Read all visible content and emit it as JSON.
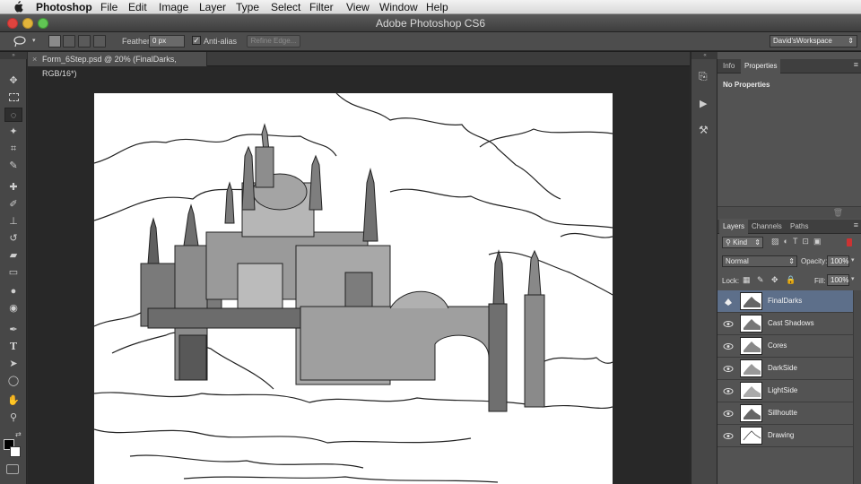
{
  "menubar": {
    "app": "Photoshop",
    "items": [
      "File",
      "Edit",
      "Image",
      "Layer",
      "Type",
      "Select",
      "Filter",
      "View",
      "Window",
      "Help"
    ]
  },
  "window": {
    "title": "Adobe Photoshop CS6"
  },
  "options": {
    "feather_label": "Feather:",
    "feather_value": "0 px",
    "antialias_label": "Anti-alias",
    "refine_edge": "Refine Edge...",
    "workspace": "David'sWorkspace"
  },
  "document": {
    "tab_title": "Form_6Step.psd @ 20% (FinalDarks, RGB/16*)",
    "close": "×"
  },
  "info_panel": {
    "tabs": [
      "Info",
      "Properties"
    ],
    "active_tab": "Properties",
    "message": "No Properties"
  },
  "layers_panel": {
    "tabs": [
      "Layers",
      "Channels",
      "Paths"
    ],
    "filter_kind": "Kind",
    "blend_mode": "Normal",
    "opacity_label": "Opacity:",
    "opacity_value": "100%",
    "lock_label": "Lock:",
    "fill_label": "Fill:",
    "fill_value": "100%",
    "layers": [
      {
        "name": "FinalDarks",
        "selected": true
      },
      {
        "name": "Cast Shadows",
        "selected": false
      },
      {
        "name": "Cores",
        "selected": false
      },
      {
        "name": "DarkSide",
        "selected": false
      },
      {
        "name": "LightSide",
        "selected": false
      },
      {
        "name": "Sillhoutte",
        "selected": false
      },
      {
        "name": "Drawing",
        "selected": false
      }
    ]
  },
  "tools": [
    "move-tool",
    "marquee-tool",
    "lasso-tool",
    "magic-wand-tool",
    "crop-tool",
    "eyedropper-tool",
    "healing-brush-tool",
    "brush-tool",
    "clone-stamp-tool",
    "history-brush-tool",
    "eraser-tool",
    "gradient-tool",
    "blur-tool",
    "dodge-tool",
    "pen-tool",
    "type-tool",
    "path-selection-tool",
    "ellipse-tool",
    "hand-tool",
    "zoom-tool"
  ],
  "colors": {
    "accent_selected": "#5d6f8a",
    "panel": "#535353",
    "chrome": "#474747"
  }
}
